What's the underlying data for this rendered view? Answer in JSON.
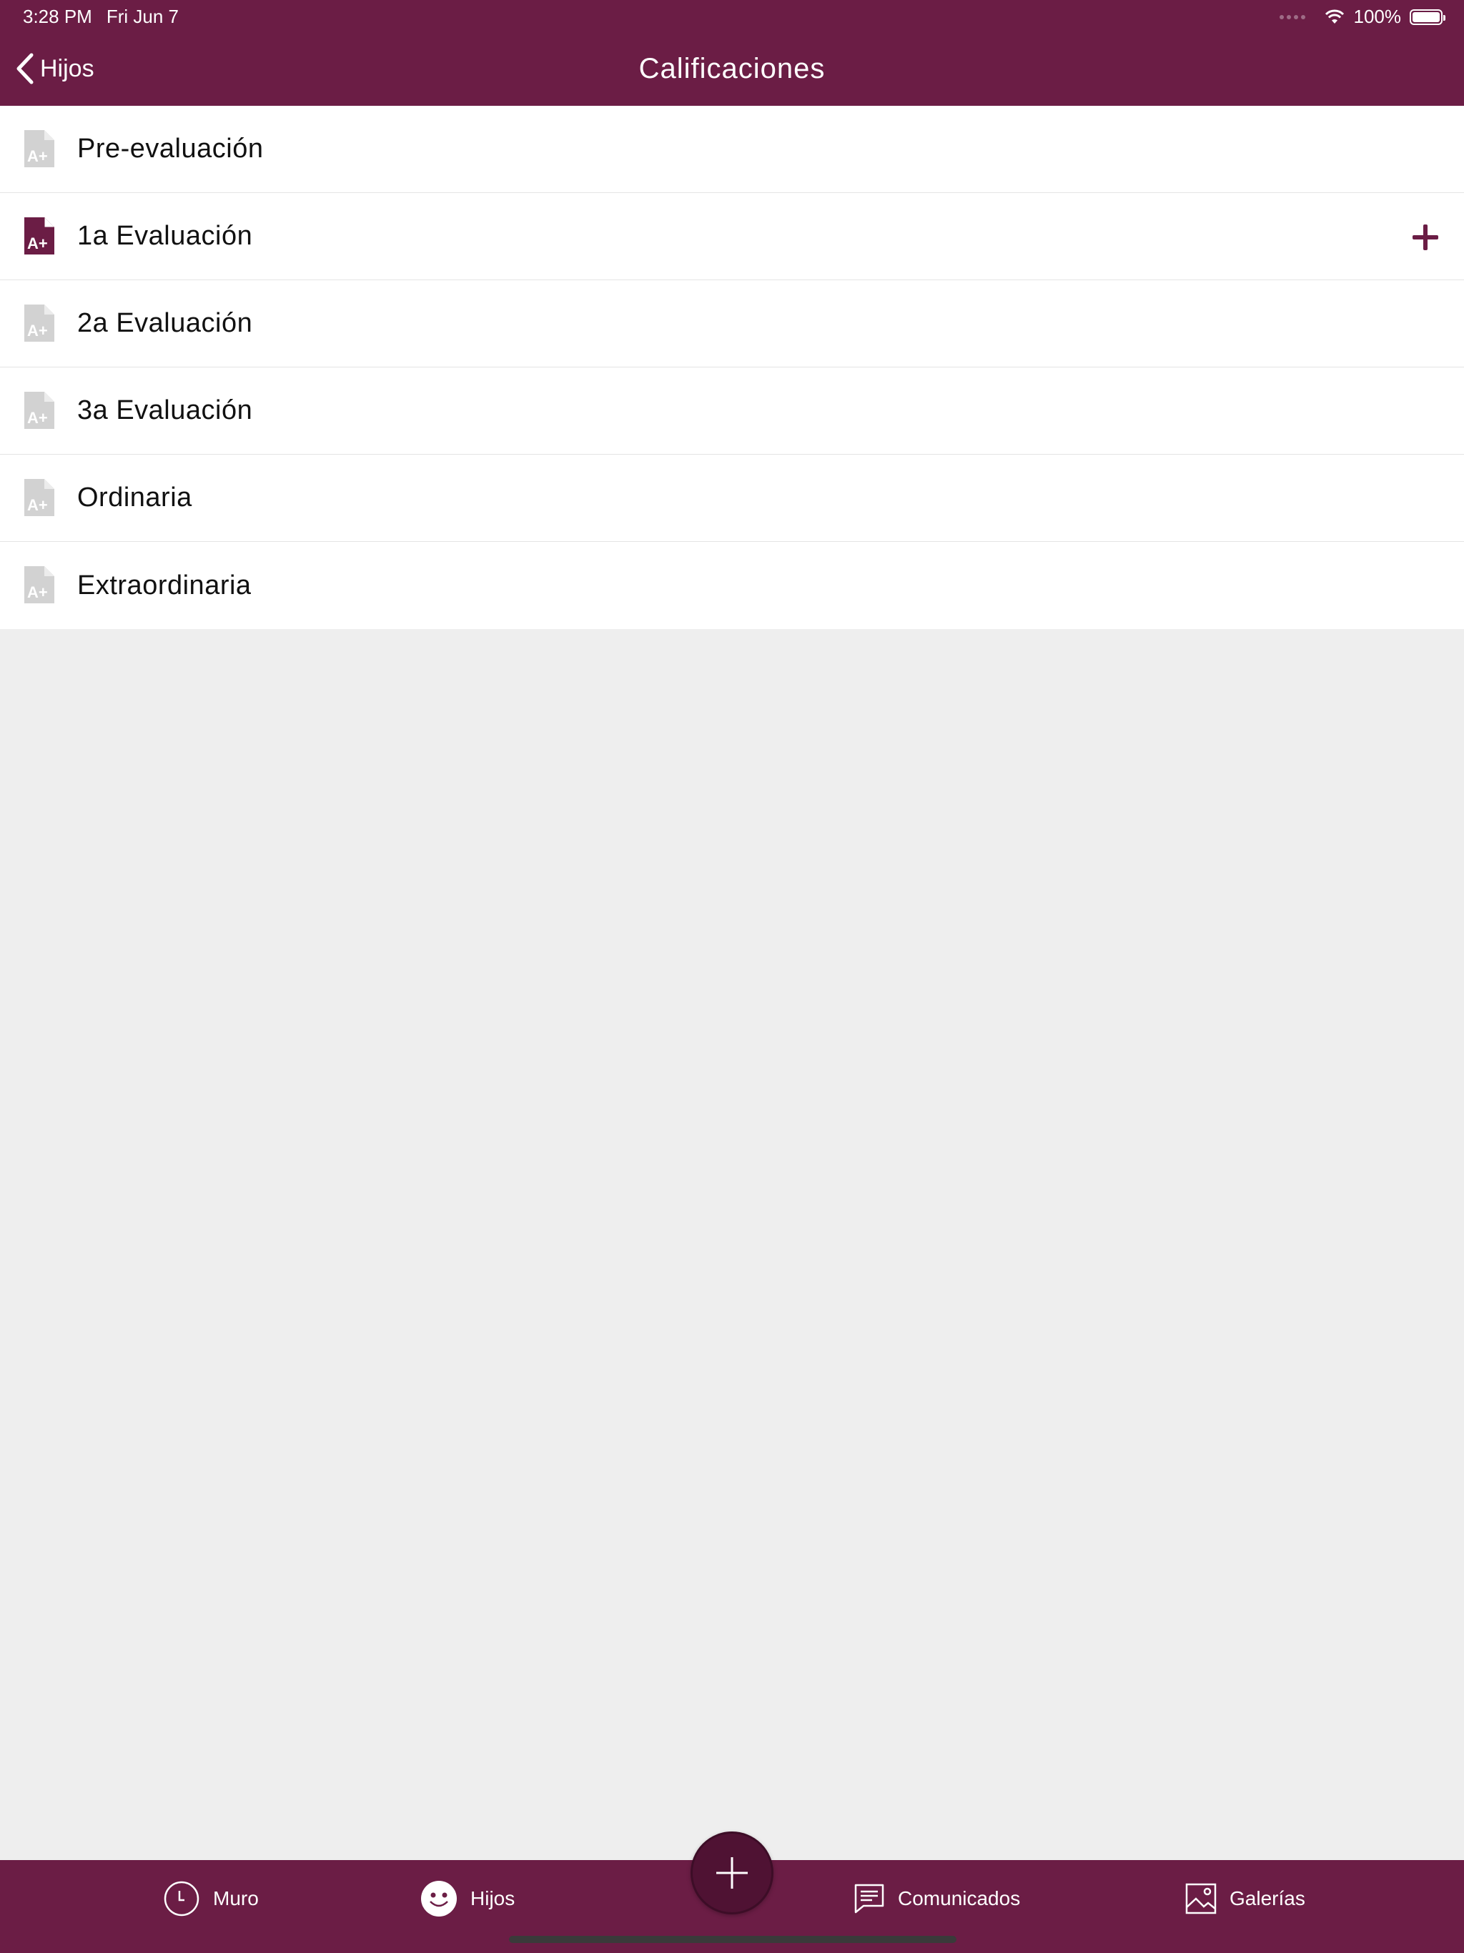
{
  "status_bar": {
    "time": "3:28 PM",
    "date": "Fri Jun 7",
    "battery": "100%",
    "wifi_icon": "wifi-icon",
    "battery_icon": "battery-icon"
  },
  "nav": {
    "back_label": "Hijos",
    "title": "Calificaciones"
  },
  "list": {
    "items": [
      {
        "label": "Pre-evaluación",
        "active": false
      },
      {
        "label": "1a Evaluación",
        "active": true
      },
      {
        "label": "2a Evaluación",
        "active": false
      },
      {
        "label": "3a Evaluación",
        "active": false
      },
      {
        "label": "Ordinaria",
        "active": false
      },
      {
        "label": "Extraordinaria",
        "active": false
      }
    ]
  },
  "tabbar": {
    "muro": "Muro",
    "hijos": "Hijos",
    "comunicados": "Comunicados",
    "galerias": "Galerías"
  },
  "colors": {
    "brand": "#6b1d45",
    "brand_dark": "#4f1233",
    "inactive_icon": "#d2d2d2",
    "background": "#eeeeee"
  }
}
